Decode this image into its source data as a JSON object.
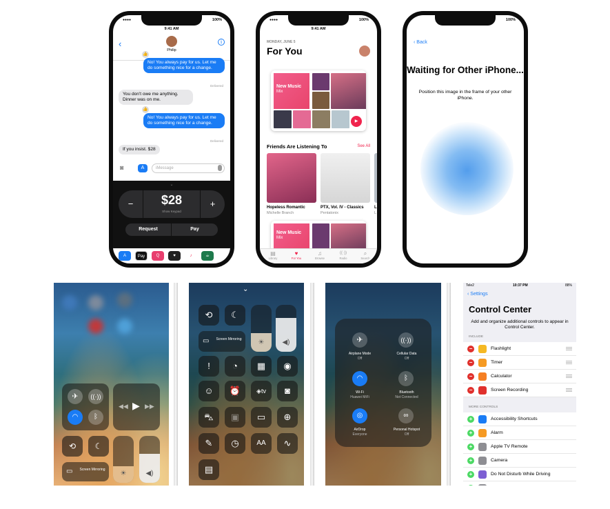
{
  "colors": {
    "ios_blue": "#1a7cf5",
    "music_red": "#f0244d",
    "delete_red": "#e0302c",
    "add_green": "#4cd964"
  },
  "messages": {
    "status_time": "9:41 AM",
    "battery": "100%",
    "contact_name": "Philip",
    "bubbles": [
      {
        "from": "me",
        "text": "No! You always pay for us. Let me do something nice for a change."
      },
      {
        "from": "them",
        "text": "You don't owe me anything. Dinner was on me."
      },
      {
        "from": "me",
        "text": "No! You always pay for us. Let me do something nice for a change."
      },
      {
        "from": "them",
        "text": "If you insist. $28"
      }
    ],
    "delivered_label": "Delivered",
    "input_placeholder": "iMessage",
    "pay": {
      "minus": "−",
      "plus": "+",
      "amount": "$28",
      "keypad_hint": "Show Keypad",
      "request_label": "Request",
      "pay_label": "Pay"
    },
    "app_strip": [
      "A",
      "Pay",
      "Q",
      "♥",
      "♪",
      "☕"
    ]
  },
  "music": {
    "status_time": "9:41 AM",
    "battery": "100%",
    "date": "MONDAY, JUNE 5",
    "title": "For You",
    "mix_title": "New Music",
    "mix_sub": "Mix",
    "friends_heading": "Friends Are Listening To",
    "see_all": "See All",
    "albums": [
      {
        "title": "Hopeless Romantic",
        "artist": "Michelle Branch"
      },
      {
        "title": "PTX, Vol. IV - Classics",
        "artist": "Pentatonix"
      },
      {
        "title": "L",
        "artist": "L"
      }
    ],
    "tabs": [
      {
        "icon": "▤",
        "label": "Library"
      },
      {
        "icon": "♥",
        "label": "For You"
      },
      {
        "icon": "♫",
        "label": "Browse"
      },
      {
        "icon": "((·))",
        "label": "Radio"
      },
      {
        "icon": "⌕",
        "label": "Search"
      }
    ]
  },
  "setup": {
    "battery": "100%",
    "back_label": "Back",
    "title": "Waiting for Other iPhone...",
    "subtitle": "Position this image in the frame of your other iPhone."
  },
  "control_center_expanded": {
    "screen_mirroring": "Screen Mirroring",
    "airplane_mode": {
      "label": "Airplane Mode",
      "state": "Off"
    },
    "cellular": {
      "label": "Cellular Data",
      "state": "Off"
    },
    "wifi": {
      "label": "Wi-Fi",
      "state": "Huawei MiFi"
    },
    "bluetooth": {
      "label": "Bluetooth",
      "state": "Not Connected"
    },
    "airdrop": {
      "label": "AirDrop",
      "state": "Everyone"
    },
    "hotspot": {
      "label": "Personal Hotspot",
      "state": "Off"
    },
    "appletv_label": "tv",
    "text_size_label": "AA"
  },
  "settings": {
    "carrier": "Tele2",
    "time": "10:37 PM",
    "battery": "88%",
    "back_label": "Settings",
    "title": "Control Center",
    "description": "Add and organize additional controls to appear in Control Center.",
    "include_header": "INCLUDE",
    "more_header": "MORE CONTROLS",
    "include": [
      {
        "label": "Flashlight",
        "icon": "flashlight-icon",
        "color": "#f5b823"
      },
      {
        "label": "Timer",
        "icon": "timer-icon",
        "color": "#f59a23"
      },
      {
        "label": "Calculator",
        "icon": "calculator-icon",
        "color": "#f57f23"
      },
      {
        "label": "Screen Recording",
        "icon": "record-icon",
        "color": "#e0302c"
      }
    ],
    "more": [
      {
        "label": "Accessibility Shortcuts",
        "icon": "accessibility-icon",
        "color": "#1a7cf5"
      },
      {
        "label": "Alarm",
        "icon": "alarm-icon",
        "color": "#f59a23"
      },
      {
        "label": "Apple TV Remote",
        "icon": "appletv-icon",
        "color": "#8e8e93"
      },
      {
        "label": "Camera",
        "icon": "camera-icon",
        "color": "#8e8e93"
      },
      {
        "label": "Do Not Disturb While Driving",
        "icon": "car-icon",
        "color": "#7d5fd3"
      },
      {
        "label": "Guided Access",
        "icon": "lock-icon",
        "color": "#8e8e93"
      }
    ]
  }
}
